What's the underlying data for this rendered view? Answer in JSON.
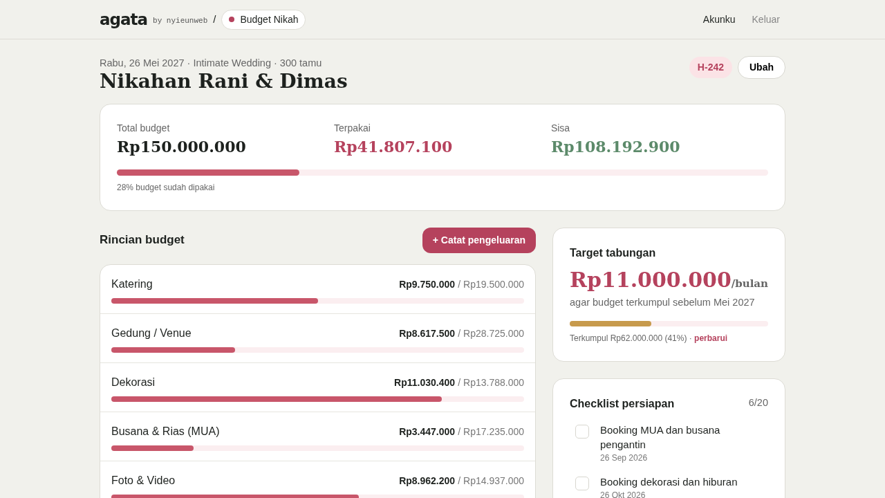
{
  "header": {
    "logo": "agata",
    "byline": "by nyieunweb",
    "separator": "/",
    "app_pill": {
      "label": "Budget Nikah",
      "color": "#b5425d"
    },
    "nav": [
      {
        "label": "Akunku",
        "selected": true
      },
      {
        "label": "Keluar",
        "selected": false
      }
    ]
  },
  "event": {
    "meta": "Rabu, 26 Mei 2027 · Intimate Wedding · 300 tamu",
    "title": "Nikahan Rani & Dimas",
    "countdown": "H-242",
    "edit_button": "Ubah"
  },
  "summary": {
    "stats": [
      {
        "label": "Total budget",
        "value": "Rp150.000.000",
        "color": "#1d211e"
      },
      {
        "label": "Terpakai",
        "value": "Rp41.807.100",
        "color": "#b5425d"
      },
      {
        "label": "Sisa",
        "value": "Rp108.192.900",
        "color": "#5c8a6a"
      }
    ],
    "level": 0.28,
    "caption": "28% budget sudah dipakai"
  },
  "breakdown": {
    "title": "Rincian budget",
    "add_button": "+ Catat pengeluaran",
    "items": [
      {
        "name": "Katering",
        "spent": "Rp9.750.000",
        "budget": "/ Rp19.500.000",
        "level": 0.5
      },
      {
        "name": "Gedung / Venue",
        "spent": "Rp8.617.500",
        "budget": "/ Rp28.725.000",
        "level": 0.3
      },
      {
        "name": "Dekorasi",
        "spent": "Rp11.030.400",
        "budget": "/ Rp13.788.000",
        "level": 0.8
      },
      {
        "name": "Busana & Rias (MUA)",
        "spent": "Rp3.447.000",
        "budget": "/ Rp17.235.000",
        "level": 0.2
      },
      {
        "name": "Foto & Video",
        "spent": "Rp8.962.200",
        "budget": "/ Rp14.937.000",
        "level": 0.6
      }
    ]
  },
  "savings": {
    "title": "Target tabungan",
    "amount": "Rp11.000.000",
    "unit": "/bulan",
    "note": "agar budget terkumpul sebelum Mei 2027",
    "level": 0.41,
    "progress_text": "Terkumpul Rp62.000.000 (41%) ·",
    "update_link": "perbarui"
  },
  "checklist": {
    "title": "Checklist persiapan",
    "count": "6/20",
    "items": [
      {
        "task": "Booking MUA dan busana pengantin",
        "date": "26 Sep 2026",
        "checked": false
      },
      {
        "task": "Booking dekorasi dan hiburan",
        "date": "26 Okt 2026",
        "checked": false
      }
    ]
  }
}
